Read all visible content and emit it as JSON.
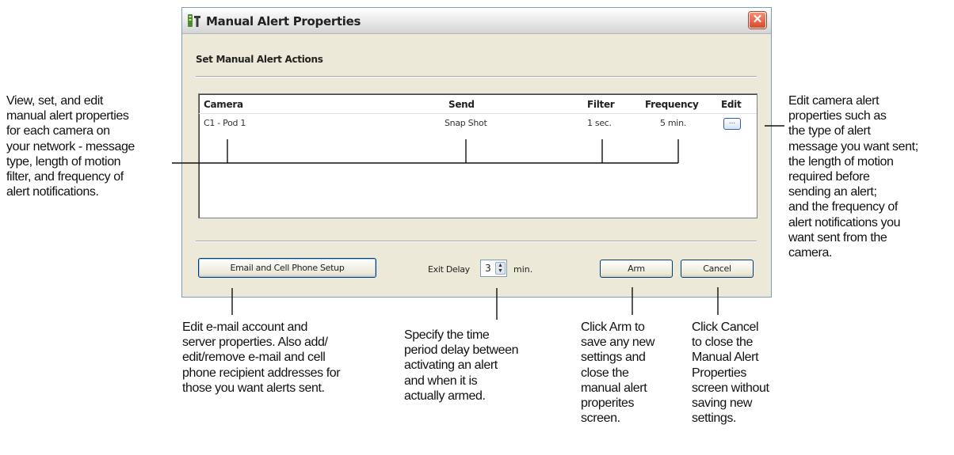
{
  "dialog": {
    "title": "Manual Alert Properties",
    "close_icon": "close-x-icon",
    "app_icon": "alert-app-icon",
    "section_title": "Set Manual Alert Actions",
    "columns": [
      "Camera",
      "Send",
      "Filter",
      "Frequency",
      "Edit"
    ],
    "rows": [
      {
        "camera": "C1 - Pod 1",
        "send": "Snap Shot",
        "filter": "1 sec.",
        "frequency": "5 min.",
        "edit": "..."
      }
    ],
    "email_button": "Email and Cell Phone Setup",
    "exit_delay_label": "Exit Delay",
    "exit_delay_value": "3",
    "exit_delay_unit": "min.",
    "arm_button": "Arm",
    "cancel_button": "Cancel"
  },
  "callouts": {
    "left": [
      "View, set, and edit",
      "manual alert properties",
      "for each camera on",
      "your network - message",
      "type, length of motion",
      "filter, and frequency of",
      "alert notifications."
    ],
    "right": [
      "Edit camera alert",
      "properties such as",
      "the type of alert",
      "message you want sent;",
      "the length of motion",
      "required before",
      "sending an alert;",
      "and the frequency of",
      "alert notifications you",
      "want sent from the",
      "camera."
    ],
    "email": [
      "Edit e-mail account and",
      "server properties. Also add/",
      "edit/remove e-mail and cell",
      "phone recipient addresses for",
      "those you want alerts sent."
    ],
    "delay": [
      "Specify the time",
      "period delay between",
      "activating an alert",
      "and when it is",
      "actually armed."
    ],
    "arm": [
      "Click Arm to",
      "save any new",
      "settings and",
      "close the",
      "manual alert",
      "properites",
      "screen."
    ],
    "cancel": [
      "Click Cancel",
      "to close the",
      "Manual Alert",
      "Properties",
      "screen without",
      "saving new",
      "settings."
    ]
  }
}
